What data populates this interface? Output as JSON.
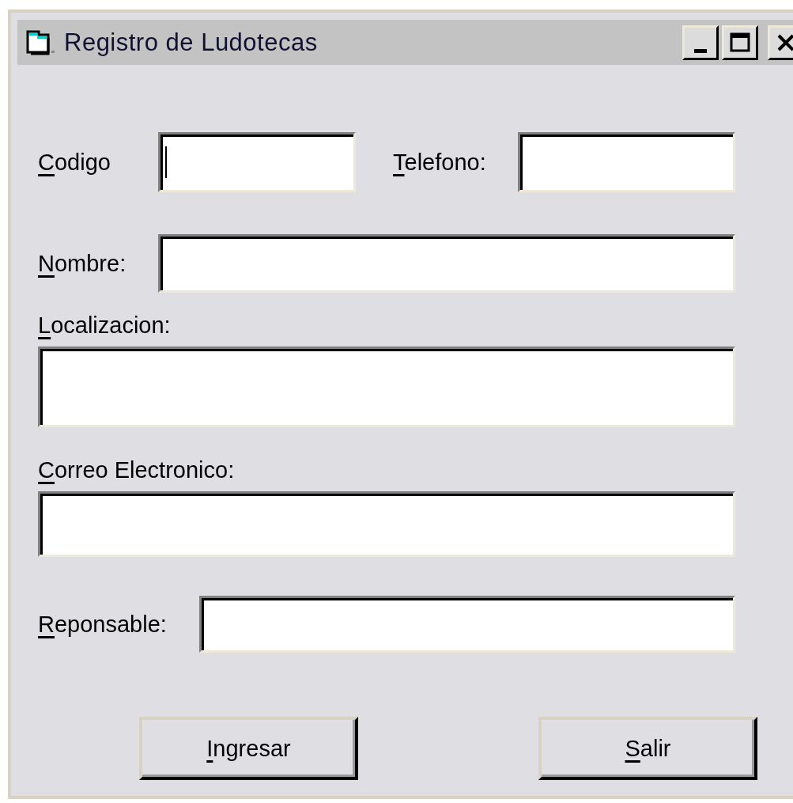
{
  "window": {
    "title": "Registro de Ludotecas",
    "controls": [
      {
        "kind": "minimize"
      },
      {
        "kind": "maximize"
      },
      {
        "kind": "close"
      }
    ]
  },
  "rows": [
    [
      {
        "label": "Codigo",
        "focused": true
      },
      {
        "label": "Telefono:",
        "focused": false
      }
    ],
    [
      {
        "label": "Nombre:",
        "focused": false
      }
    ],
    [
      {
        "label": "Localizacion:",
        "focused": false
      }
    ],
    [
      {
        "label": "Correo Electronico:",
        "focused": false
      }
    ],
    [
      {
        "label": "Reponsable:",
        "focused": false
      }
    ]
  ],
  "buttons": [
    {
      "label": "Ingresar"
    },
    {
      "label": "Salir"
    }
  ]
}
